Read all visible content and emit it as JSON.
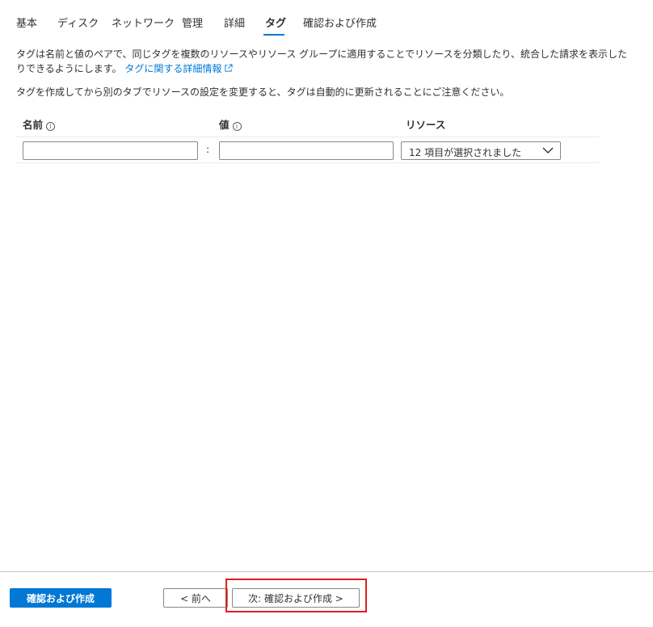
{
  "tabs": [
    {
      "label": "基本"
    },
    {
      "label": "ディスク"
    },
    {
      "label": "ネットワーク"
    },
    {
      "label": "管理"
    },
    {
      "label": "詳細"
    },
    {
      "label": "タグ"
    },
    {
      "label": "確認および作成"
    }
  ],
  "active_tab": "タグ",
  "description": {
    "text": "タグは名前と値のペアで、同じタグを複数のリソースやリソース グループに適用することでリソースを分類したり、統合した請求を表示したりできるようにします。",
    "link": "タグに関する詳細情報"
  },
  "note": "タグを作成してから別のタブでリソースの設定を変更すると、タグは自動的に更新されることにご注意ください。",
  "columns": {
    "name": "名前",
    "value": "値",
    "resource": "リソース"
  },
  "info_glyph": "i",
  "row": {
    "name_value": "",
    "tag_value": "",
    "separator": ":",
    "resource_selected": "12 項目が選択されました"
  },
  "footer": {
    "review_create": "確認および作成",
    "previous": "< 前へ",
    "next": "次: 確認および作成 >"
  },
  "colors": {
    "accent": "#0078d4",
    "highlight": "#e0201e"
  }
}
